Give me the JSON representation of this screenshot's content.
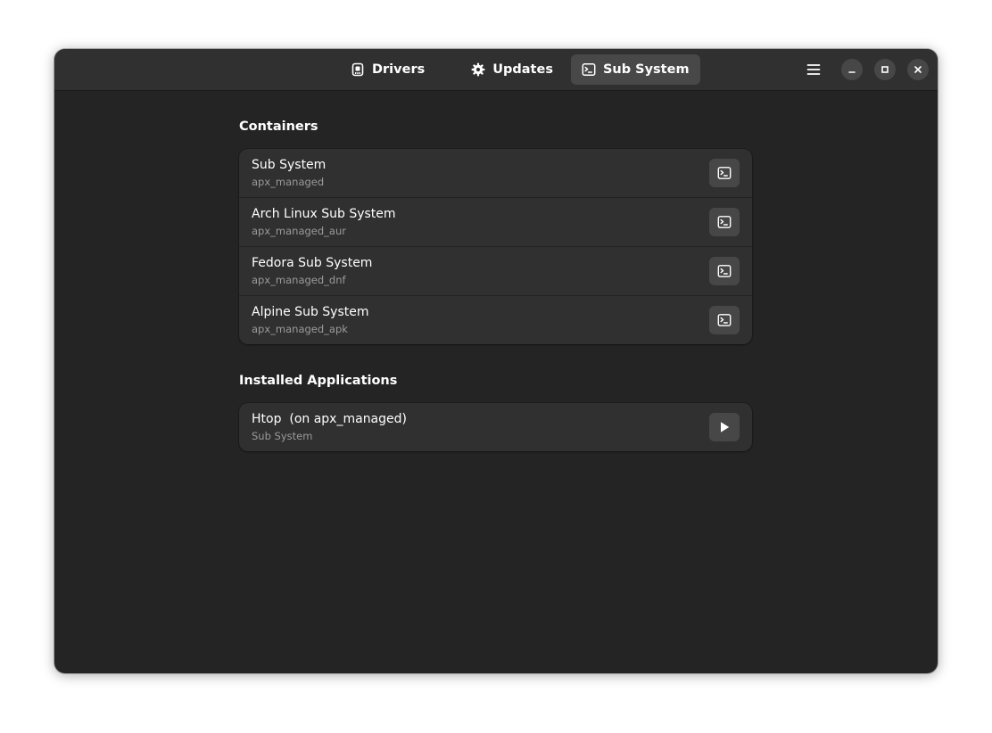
{
  "header": {
    "tabs": [
      {
        "label": "Drivers",
        "icon": "chip-icon",
        "active": false
      },
      {
        "label": "Updates",
        "icon": "gear-icon",
        "active": false
      },
      {
        "label": "Sub System",
        "icon": "terminal-icon",
        "active": true
      }
    ],
    "controls": [
      "menu-icon",
      "minimize-icon",
      "maximize-icon",
      "close-icon"
    ]
  },
  "containers": {
    "title": "Containers",
    "items": [
      {
        "title": "Sub System",
        "subtitle": "apx_managed",
        "action_icon": "terminal-icon"
      },
      {
        "title": "Arch Linux Sub System",
        "subtitle": "apx_managed_aur",
        "action_icon": "terminal-icon"
      },
      {
        "title": "Fedora Sub System",
        "subtitle": "apx_managed_dnf",
        "action_icon": "terminal-icon"
      },
      {
        "title": "Alpine Sub System",
        "subtitle": "apx_managed_apk",
        "action_icon": "terminal-icon"
      }
    ]
  },
  "applications": {
    "title": "Installed Applications",
    "items": [
      {
        "title": "Htop  (on apx_managed)",
        "subtitle": "Sub System",
        "action_icon": "play-icon"
      }
    ]
  },
  "colors": {
    "window_bg": "#242424",
    "headerbar_bg": "#303030",
    "card_bg": "#303030",
    "button_bg": "#474747",
    "subtitle_text": "#9a9a9a"
  }
}
